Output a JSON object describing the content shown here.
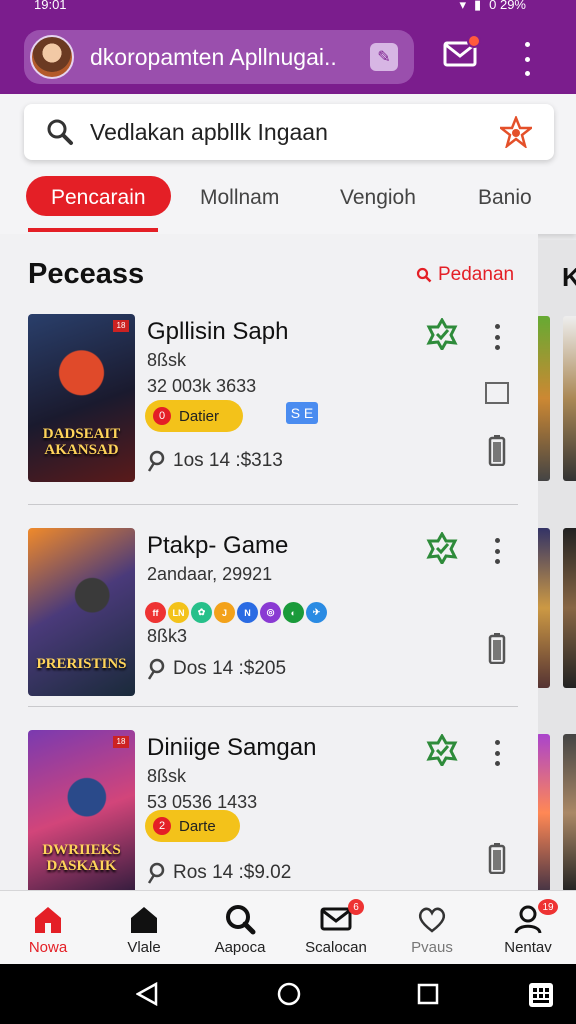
{
  "status_bar": {
    "time": "19:01",
    "battery": "0 29%"
  },
  "header": {
    "account_title": "dkoropamten Apllnugai..",
    "mail_icon": "mail-icon",
    "more_icon": "more-vert-icon"
  },
  "search": {
    "value": "Vedlakan apbllk Ingaan",
    "icon": "search-icon"
  },
  "tabs": [
    {
      "label": "Pencarain",
      "active": true
    },
    {
      "label": "Mollnam"
    },
    {
      "label": "Vengioh"
    },
    {
      "label": "Banio"
    }
  ],
  "section": {
    "title": "Peceass",
    "link": "Pedanan",
    "side_letter": "K"
  },
  "games": [
    {
      "title": "Gpllisin Saph",
      "line1": "8ßsk",
      "line2": "32 003k  3633",
      "badge": "Datier",
      "badge_dot": "0",
      "se": "S E",
      "cover_text": "DADSEAIT AKANSAD",
      "meta": "1os 14 :$313"
    },
    {
      "title": "Ptakp- Game",
      "line1": "2andaar, 29921",
      "line2": "8ßk3",
      "cover_text": "PRERISTINS",
      "meta": "Dos 14 :$205",
      "tags": [
        {
          "t": "ff",
          "c": "#e33"
        },
        {
          "t": "LN",
          "c": "#f3c21a"
        },
        {
          "t": "✿",
          "c": "#27c08a"
        },
        {
          "t": "J",
          "c": "#f3a21a"
        },
        {
          "t": "N",
          "c": "#2a6be3"
        },
        {
          "t": "◎",
          "c": "#8a3ad3"
        },
        {
          "t": "◐",
          "c": "#1a9a3a"
        },
        {
          "t": "✈",
          "c": "#2a8be3"
        }
      ]
    },
    {
      "title": "Diniige Samgan",
      "line1": "8ßsk",
      "line2": "53 0536  1433",
      "badge": "Darte",
      "badge_dot": "2",
      "cover_text": "DWRIIEKS DASKAIK",
      "meta": "Ros 14 :$9.02"
    }
  ],
  "bottom_nav": [
    {
      "label": "Nowa",
      "icon": "home-icon",
      "active": true
    },
    {
      "label": "Vlale",
      "icon": "home-outline-icon"
    },
    {
      "label": "Aapoca",
      "icon": "search-icon"
    },
    {
      "label": "Scalocan",
      "icon": "mail-icon",
      "badge": "6"
    },
    {
      "label": "Pvaus",
      "icon": "heart-icon"
    },
    {
      "label": "Nentav",
      "icon": "profile-icon",
      "badge": "19"
    }
  ],
  "colors": {
    "brand_purple": "#7b1d8d",
    "accent_red": "#e41f26",
    "badge_yellow": "#f3c21a",
    "verified_green": "#2e8b3a"
  }
}
